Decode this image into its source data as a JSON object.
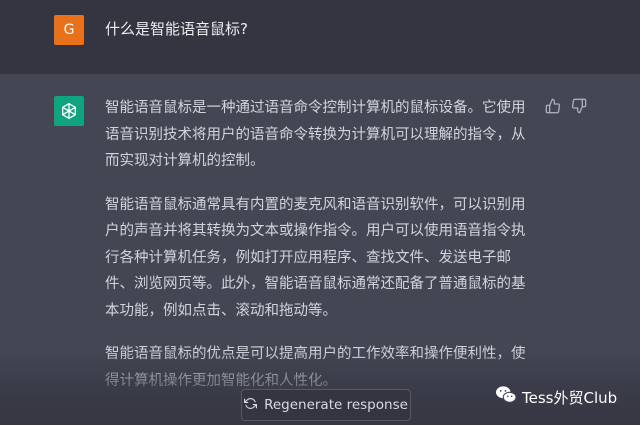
{
  "user_message": {
    "avatar_letter": "G",
    "text": "什么是智能语音鼠标?"
  },
  "assistant_message": {
    "paragraphs": [
      "智能语音鼠标是一种通过语音命令控制计算机的鼠标设备。它使用语音识别技术将用户的语音命令转换为计算机可以理解的指令，从而实现对计算机的控制。",
      "智能语音鼠标通常具有内置的麦克风和语音识别软件，可以识别用户的声音并将其转换为文本或操作指令。用户可以使用语音指令执行各种计算机任务，例如打开应用程序、查找文件、发送电子邮件、浏览网页等。此外，智能语音鼠标通常还配备了普通鼠标的基本功能，例如点击、滚动和拖动等。",
      "智能语音鼠标的优点是可以提高用户的工作效率和操作便利性，使得计算机操作更加智能化和人性化。"
    ]
  },
  "regenerate_button": {
    "label": "Regenerate response"
  },
  "watermark": {
    "text": "Tess外贸Club"
  },
  "colors": {
    "user_bg": "#343541",
    "assistant_bg": "#444654",
    "user_avatar": "#e8711a",
    "bot_avatar": "#10a37f"
  }
}
